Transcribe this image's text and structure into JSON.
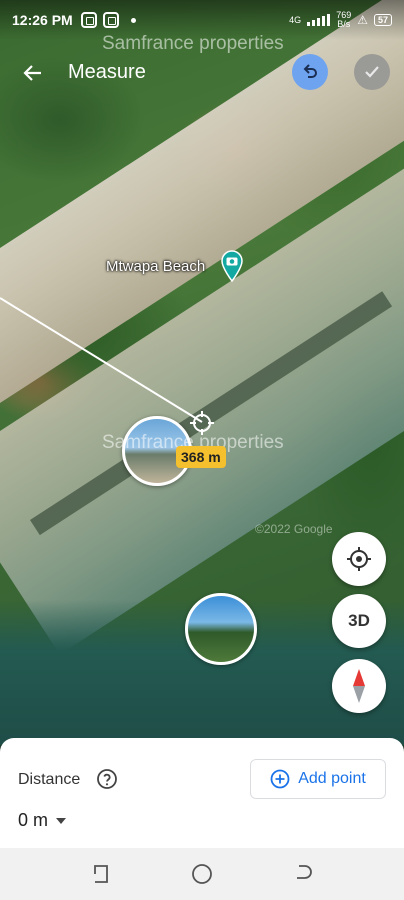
{
  "status_bar": {
    "time": "12:26 PM",
    "network": "4G",
    "speed_value": "769",
    "speed_unit": "B/s",
    "battery": "57"
  },
  "watermarks": {
    "top": "Samfrance properties",
    "middle": "Samfrance properties",
    "google": "©2022 Google"
  },
  "appbar": {
    "title": "Measure",
    "back_icon": "arrow-back-icon",
    "undo_icon": "undo-icon",
    "done_icon": "check-icon"
  },
  "map": {
    "place_label": "Mtwapa Beach",
    "place_icon": "camera-pin-icon",
    "distance_badge": "368 m"
  },
  "controls": {
    "locate_icon": "my-location-icon",
    "three_d_label": "3D",
    "compass_icon": "compass-icon"
  },
  "sheet": {
    "distance_label": "Distance",
    "help_icon": "help-icon",
    "add_point_label": "Add point",
    "distance_value": "0 m"
  },
  "colors": {
    "accent": "#1a73e8",
    "undo_bg": "#6ea3ef",
    "badge": "#f4c02e",
    "pin": "#13a9a2"
  }
}
